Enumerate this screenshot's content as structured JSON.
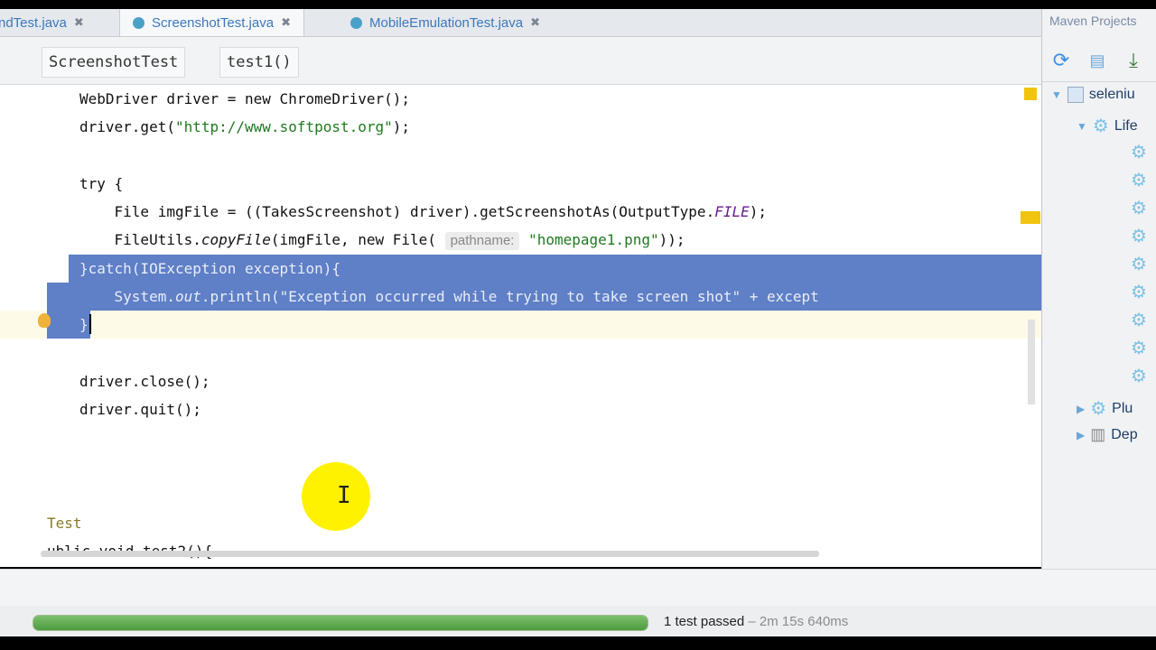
{
  "tabs": [
    {
      "label": "ndTest.java"
    },
    {
      "label": "ScreenshotTest.java",
      "active": true
    },
    {
      "label": "MobileEmulationTest.java"
    }
  ],
  "breadcrumb": {
    "items": [
      "ScreenshotTest",
      "test1()"
    ]
  },
  "code": {
    "line1": {
      "prefix": "WebDriver driver = new ChromeDriver();"
    },
    "line2": {
      "a": "driver.get(",
      "s": "\"http://www.softpost.org\"",
      "b": ");"
    },
    "line3": {
      "a": "try {"
    },
    "line4": {
      "a": "    File imgFile = ((TakesScreenshot) driver).getScreenshotAs(OutputType.",
      "fld": "FILE",
      "b": ");"
    },
    "line5": {
      "a": "    FileUtils.",
      "m": "copyFile",
      "b": "(imgFile, new File( ",
      "hint": "pathname:",
      "s": "\"homepage1.png\"",
      "c": "));"
    },
    "line6": {
      "a": "}catch(IOException exception){"
    },
    "line7": {
      "a": "    System.",
      "fld": "out",
      "b": ".println(\"Exception occurred while trying to take screen shot\" + except"
    },
    "line8": {
      "a": "}"
    },
    "line9": {
      "a": "driver.close();"
    },
    "line10": {
      "a": "driver.quit();"
    },
    "line11": {
      "a": "Test"
    },
    "line12": {
      "a": "ublic void test2(){"
    }
  },
  "maven_panel": {
    "title": "Maven Projects",
    "toolbar": [
      "refresh-icon",
      "add-project-icon",
      "download-icon"
    ],
    "project": "seleniu",
    "lifecycle": "Life",
    "plugins": "Plu",
    "dependencies": "Dep"
  },
  "run_status": {
    "progress": 1.0,
    "result": "1 test passed",
    "duration": "– 2m 15s 640ms"
  }
}
